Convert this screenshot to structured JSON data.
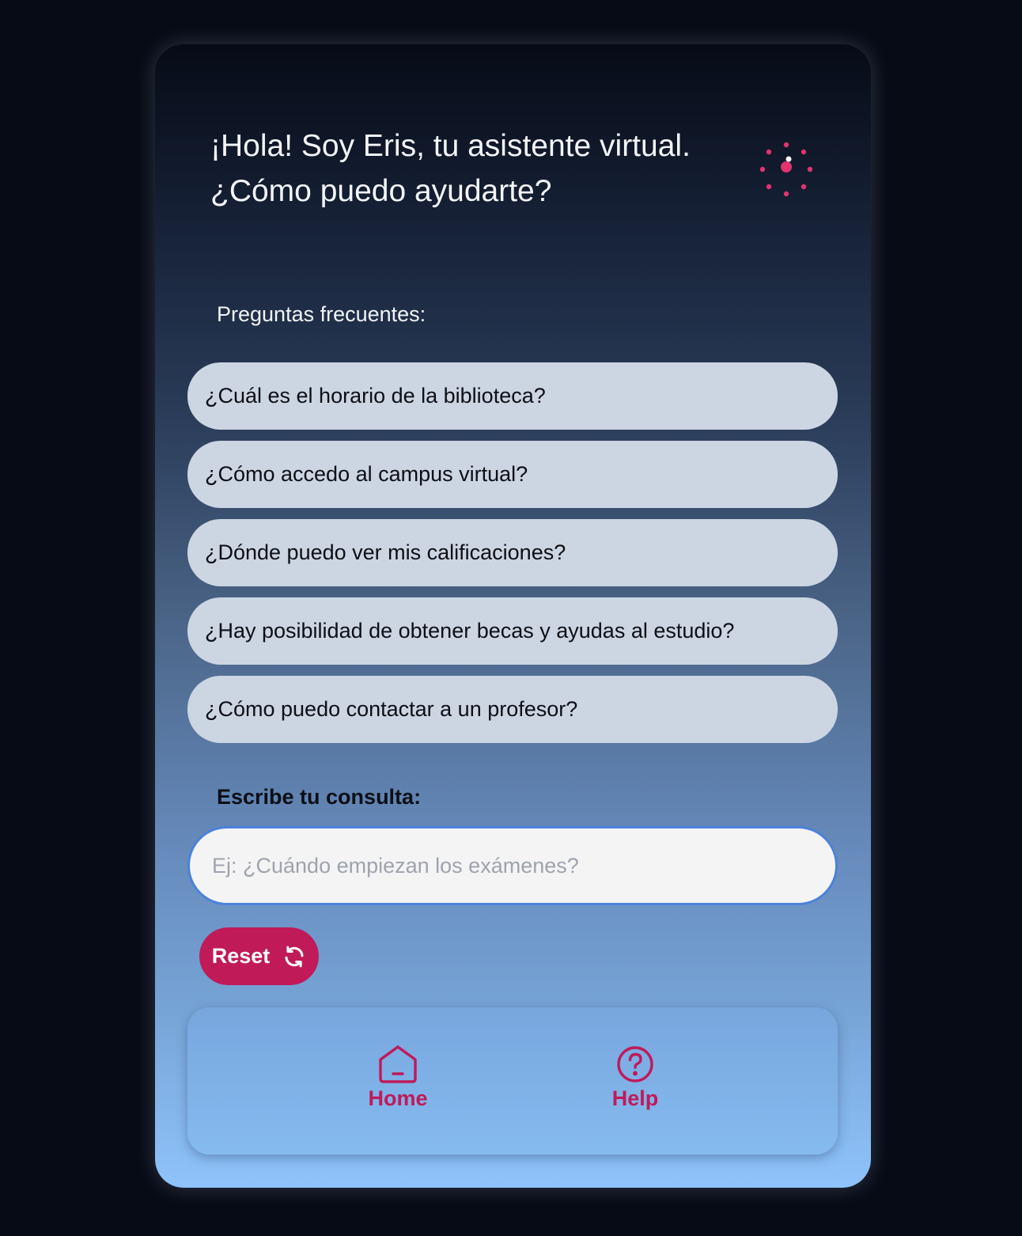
{
  "greeting": {
    "line1": "¡Hola! Soy Eris, tu asistente virtual.",
    "line2": "¿Cómo puedo ayudarte?"
  },
  "spinner_icon": "loading-dots-icon",
  "faq": {
    "title": "Preguntas frecuentes:",
    "items": [
      "¿Cuál es el horario de la biblioteca?",
      "¿Cómo accedo al campus virtual?",
      "¿Dónde puedo ver mis calificaciones?",
      "¿Hay posibilidad de obtener becas y ayudas al estudio?",
      "¿Cómo puedo contactar a un profesor?"
    ]
  },
  "query": {
    "label": "Escribe tu consulta:",
    "placeholder": "Ej: ¿Cuándo empiezan los exámenes?",
    "value": ""
  },
  "reset": {
    "label": "Reset",
    "icon": "refresh-icon"
  },
  "nav": {
    "home": {
      "label": "Home",
      "icon": "home-icon"
    },
    "help": {
      "label": "Help",
      "icon": "help-circle-icon"
    }
  },
  "colors": {
    "accent": "#c01a59",
    "spinner": "#e0336f",
    "faq_button": "#ccd5e2",
    "input_border": "#4a82da",
    "page_background": "#070b16"
  }
}
